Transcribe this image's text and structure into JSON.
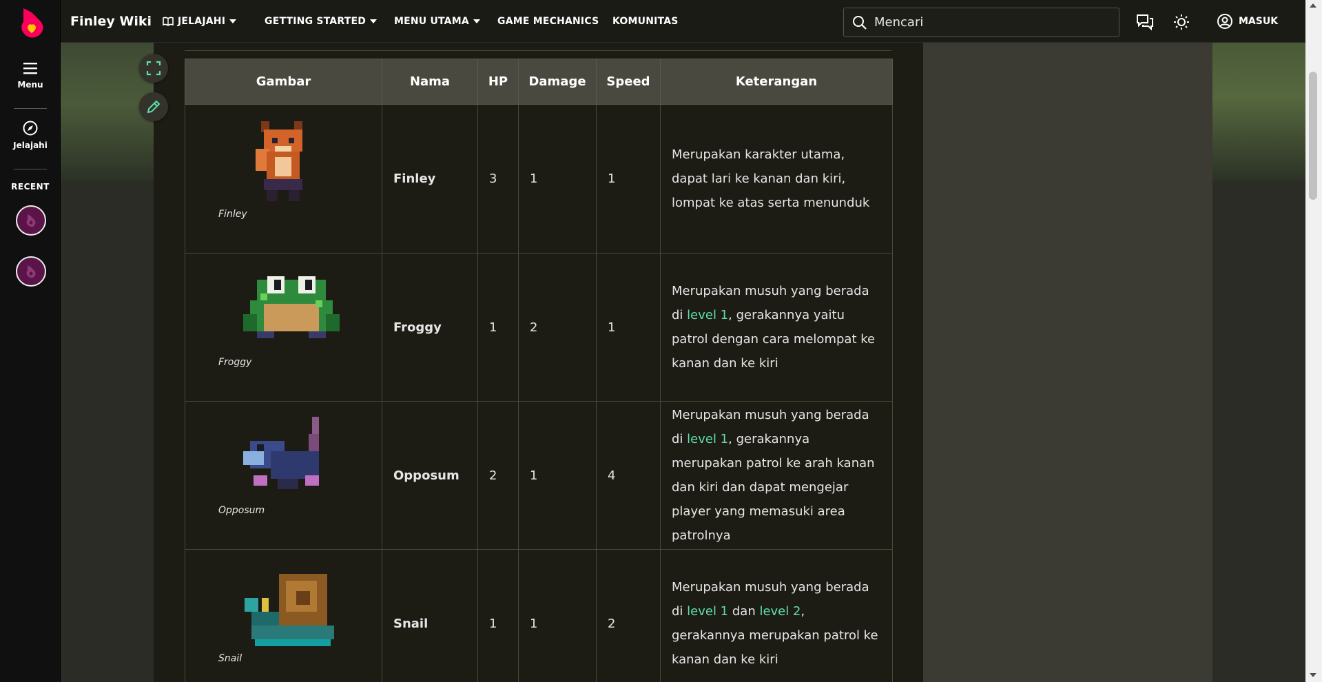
{
  "rail": {
    "menu_label": "Menu",
    "explore_label": "Jelajahi",
    "recent_label": "RECENT"
  },
  "topbar": {
    "wiki_name": "Finley Wiki",
    "nav": [
      "JELAJAHI",
      "GETTING STARTED",
      "MENU UTAMA",
      "GAME MECHANICS",
      "KOMUNITAS"
    ],
    "search_placeholder": "Mencari",
    "signin_label": "MASUK"
  },
  "table": {
    "headers": [
      "Gambar",
      "Nama",
      "HP",
      "Damage",
      "Speed",
      "Keterangan"
    ],
    "rows": [
      {
        "caption": "Finley",
        "name": "Finley",
        "hp": "3",
        "damage": "1",
        "speed": "1",
        "desc_pre": "Merupakan karakter utama, dapat lari ke kanan dan kiri, lompat ke atas serta menunduk",
        "link1": "",
        "desc_mid": "",
        "link2": "",
        "desc_post": ""
      },
      {
        "caption": "Froggy",
        "name": "Froggy",
        "hp": "1",
        "damage": "2",
        "speed": "1",
        "desc_pre": "Merupakan musuh yang berada di ",
        "link1": "level 1",
        "desc_mid": ", gerakannya yaitu patrol dengan cara melompat ke kanan dan ke kiri",
        "link2": "",
        "desc_post": ""
      },
      {
        "caption": "Opposum",
        "name": "Opposum",
        "hp": "2",
        "damage": "1",
        "speed": "4",
        "desc_pre": "Merupakan musuh yang berada di ",
        "link1": "level 1",
        "desc_mid": ", gerakannya merupakan patrol ke arah kanan dan kiri dan dapat mengejar player yang memasuki area patrolnya",
        "link2": "",
        "desc_post": ""
      },
      {
        "caption": "Snail",
        "name": "Snail",
        "hp": "1",
        "damage": "1",
        "speed": "2",
        "desc_pre": "Merupakan musuh yang berada di ",
        "link1": "level 1",
        "desc_mid": " dan ",
        "link2": "level 2",
        "desc_post": ", gerakannya merupakan patrol ke kanan dan ke kiri"
      }
    ]
  },
  "colors": {
    "accent": "#5fe0a8",
    "brand": "#fa005a",
    "header_bg": "#4a4940",
    "page_bg": "#1c1b14"
  },
  "icons": [
    "fandom-logo-icon",
    "menu-icon",
    "compass-icon",
    "fandom-recent-icon",
    "search-icon",
    "discussions-icon",
    "theme-toggle-icon",
    "user-icon",
    "fullscreen-icon",
    "edit-pencil-icon"
  ]
}
